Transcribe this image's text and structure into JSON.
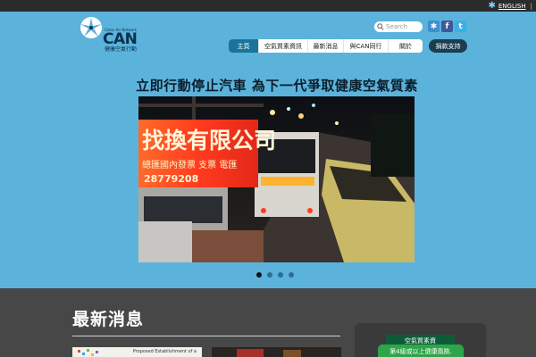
{
  "topbar": {
    "language_link": "ENGLISH",
    "separator": "|"
  },
  "logo": {
    "tagline": "Clean Air Network",
    "wordmark": "CAN",
    "chinese_name": "健康空氣行動"
  },
  "search": {
    "placeholder": "Search"
  },
  "social": [
    {
      "name": "can-icon",
      "glyph": "✱"
    },
    {
      "name": "facebook-icon",
      "glyph": "f"
    },
    {
      "name": "twitter-icon",
      "glyph": "t"
    }
  ],
  "nav": {
    "items": [
      {
        "label": "主頁",
        "active": true
      },
      {
        "label": "空氣質素資訊",
        "active": false
      },
      {
        "label": "最新消息",
        "active": false
      },
      {
        "label": "與CAN同行",
        "active": false
      },
      {
        "label": "關於",
        "active": false
      }
    ],
    "donate_label": "捐款支持"
  },
  "hero": {
    "title": "立即行動停止汽車 為下一代爭取健康空氣質素"
  },
  "slideshow": {
    "sign_text": "找換有限公司",
    "sign_sub": "總匯國內發票 支票 電匯",
    "sign_phone": "28779208",
    "dots": [
      {
        "active": true
      },
      {
        "active": false
      },
      {
        "active": false
      },
      {
        "active": false
      }
    ]
  },
  "news": {
    "title": "最新消息",
    "thumb1_caption": "Proposed Establishment of a"
  },
  "panel": {
    "tab_label": "空氣質素資",
    "body_text": "第4級或以上健康風險."
  },
  "colors": {
    "background": "#5bb3dc",
    "nav_active": "#19749a",
    "donate": "#1c3e52",
    "footer": "#474747",
    "panel_green": "#2fa54a"
  }
}
